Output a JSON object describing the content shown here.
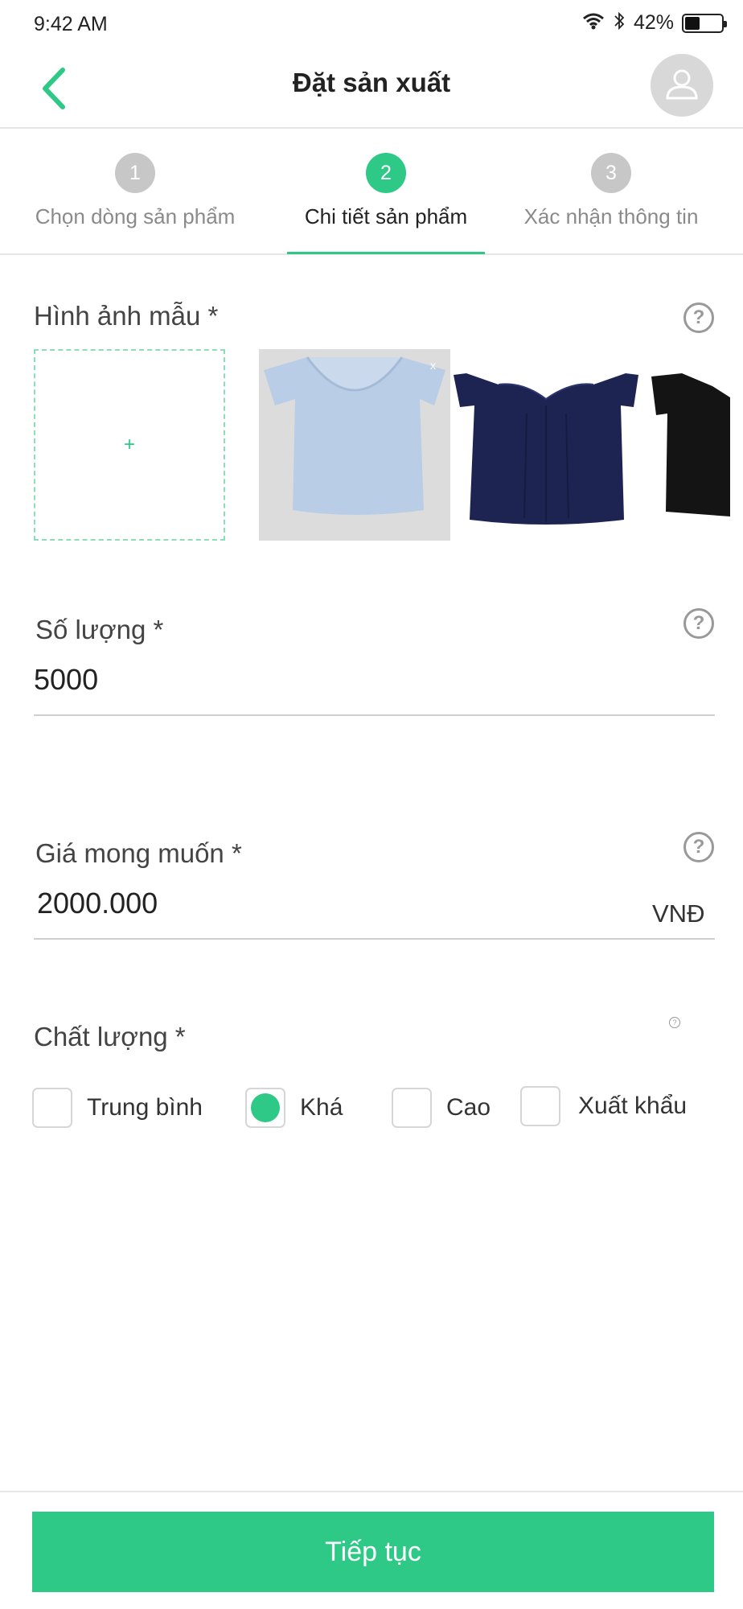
{
  "status_bar": {
    "time": "9:42 AM",
    "battery_percent_label": "42%",
    "battery_level": 0.42
  },
  "nav": {
    "title": "Đặt sản xuất",
    "back_icon": "chevron-left-icon",
    "avatar_icon": "user-icon"
  },
  "stepper": {
    "steps": [
      {
        "number": "1",
        "label": "Chọn dòng sản phẩm",
        "active": false
      },
      {
        "number": "2",
        "label": "Chi tiết sản phẩm",
        "active": true
      },
      {
        "number": "3",
        "label": "Xác nhận thông tin",
        "active": false
      }
    ]
  },
  "sample_images": {
    "label": "Hình ảnh mẫu *",
    "upload_symbol": "+",
    "remove_symbol": "x",
    "help_symbol": "?"
  },
  "quantity": {
    "label": "Số lượng *",
    "value": "5000",
    "help_symbol": "?"
  },
  "price": {
    "label": "Giá mong muốn *",
    "value": "2000.000",
    "unit": "VNĐ",
    "help_symbol": "?"
  },
  "quality": {
    "label": "Chất lượng *",
    "help_symbol": "?",
    "options": [
      {
        "label": "Trung bình",
        "selected": false
      },
      {
        "label": "Khá",
        "selected": true
      },
      {
        "label": "Cao",
        "selected": false
      },
      {
        "label": "Xuất khẩu",
        "selected": false
      }
    ]
  },
  "footer": {
    "continue_label": "Tiếp tục"
  },
  "colors": {
    "accent": "#2ec986",
    "step_inactive": "#c7c7c7",
    "divider": "#e6e6e6",
    "thumb_light_blue": "#b9cde6",
    "thumb_navy": "#1e2452",
    "thumb_black": "#141414"
  }
}
